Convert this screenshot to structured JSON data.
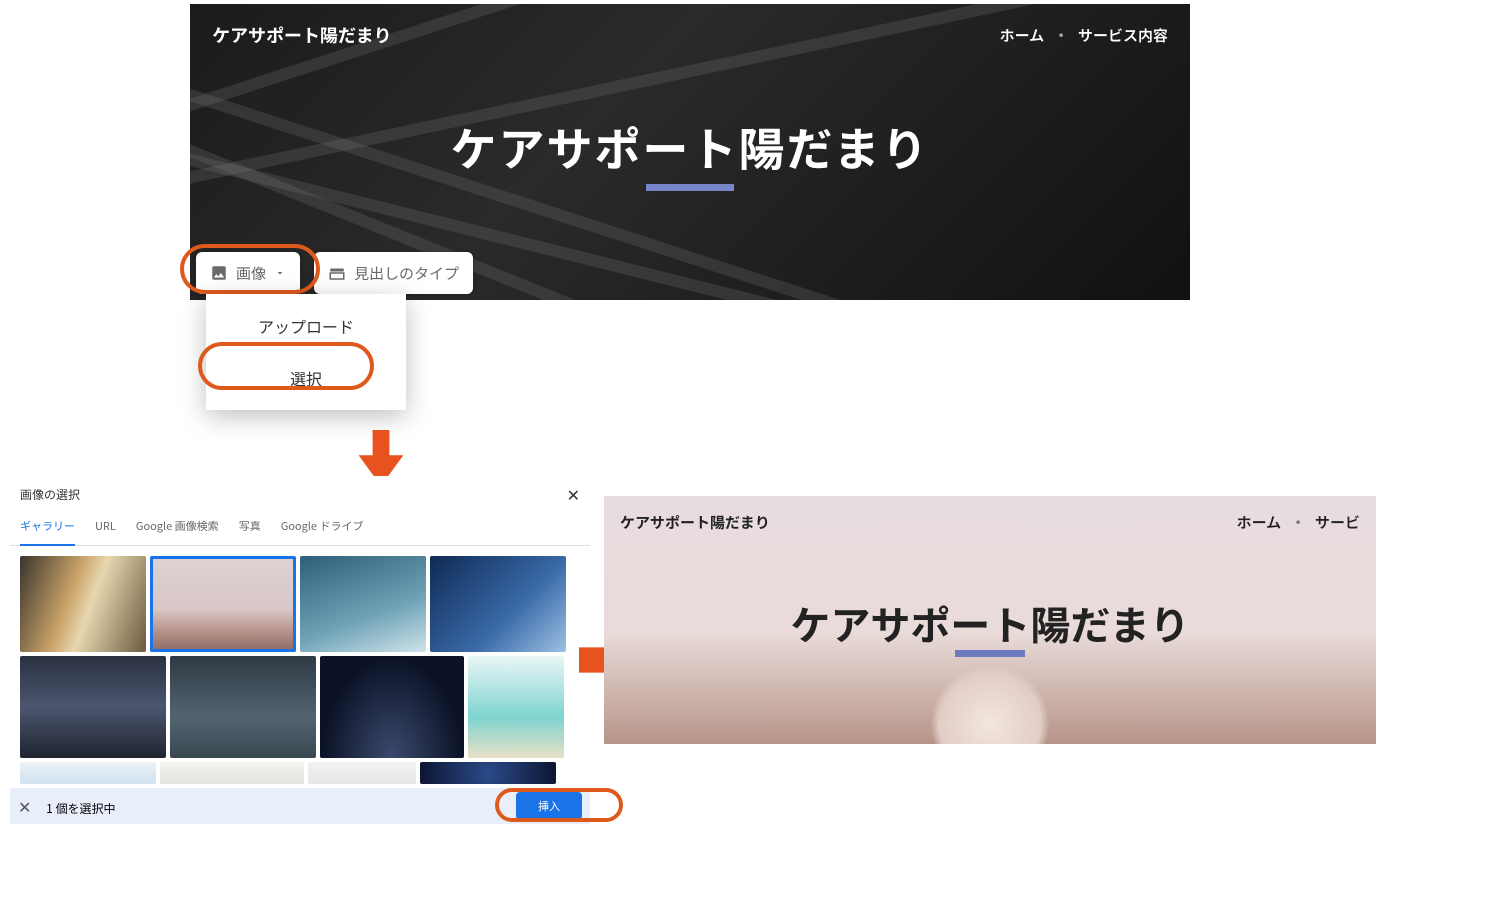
{
  "panel1": {
    "brand": "ケアサポート陽だまり",
    "nav": {
      "home": "ホーム",
      "services": "サービス内容",
      "separator": "・"
    },
    "title": "ケアサポート陽だまり",
    "toolbar": {
      "image_label": "画像",
      "heading_type_label": "見出しのタイプ"
    },
    "image_menu": {
      "upload": "アップロード",
      "select": "選択"
    }
  },
  "picker": {
    "title": "画像の選択",
    "tabs": {
      "gallery": "ギャラリー",
      "url": "URL",
      "google_images": "Google 画像検索",
      "photos": "写真",
      "drive": "Google ドライブ"
    },
    "status": "1 個を選択中",
    "insert": "挿入"
  },
  "panel3": {
    "brand": "ケアサポート陽だまり",
    "nav": {
      "home": "ホーム",
      "services": "サービ",
      "separator": "・"
    },
    "title": "ケアサポート陽だまり"
  }
}
